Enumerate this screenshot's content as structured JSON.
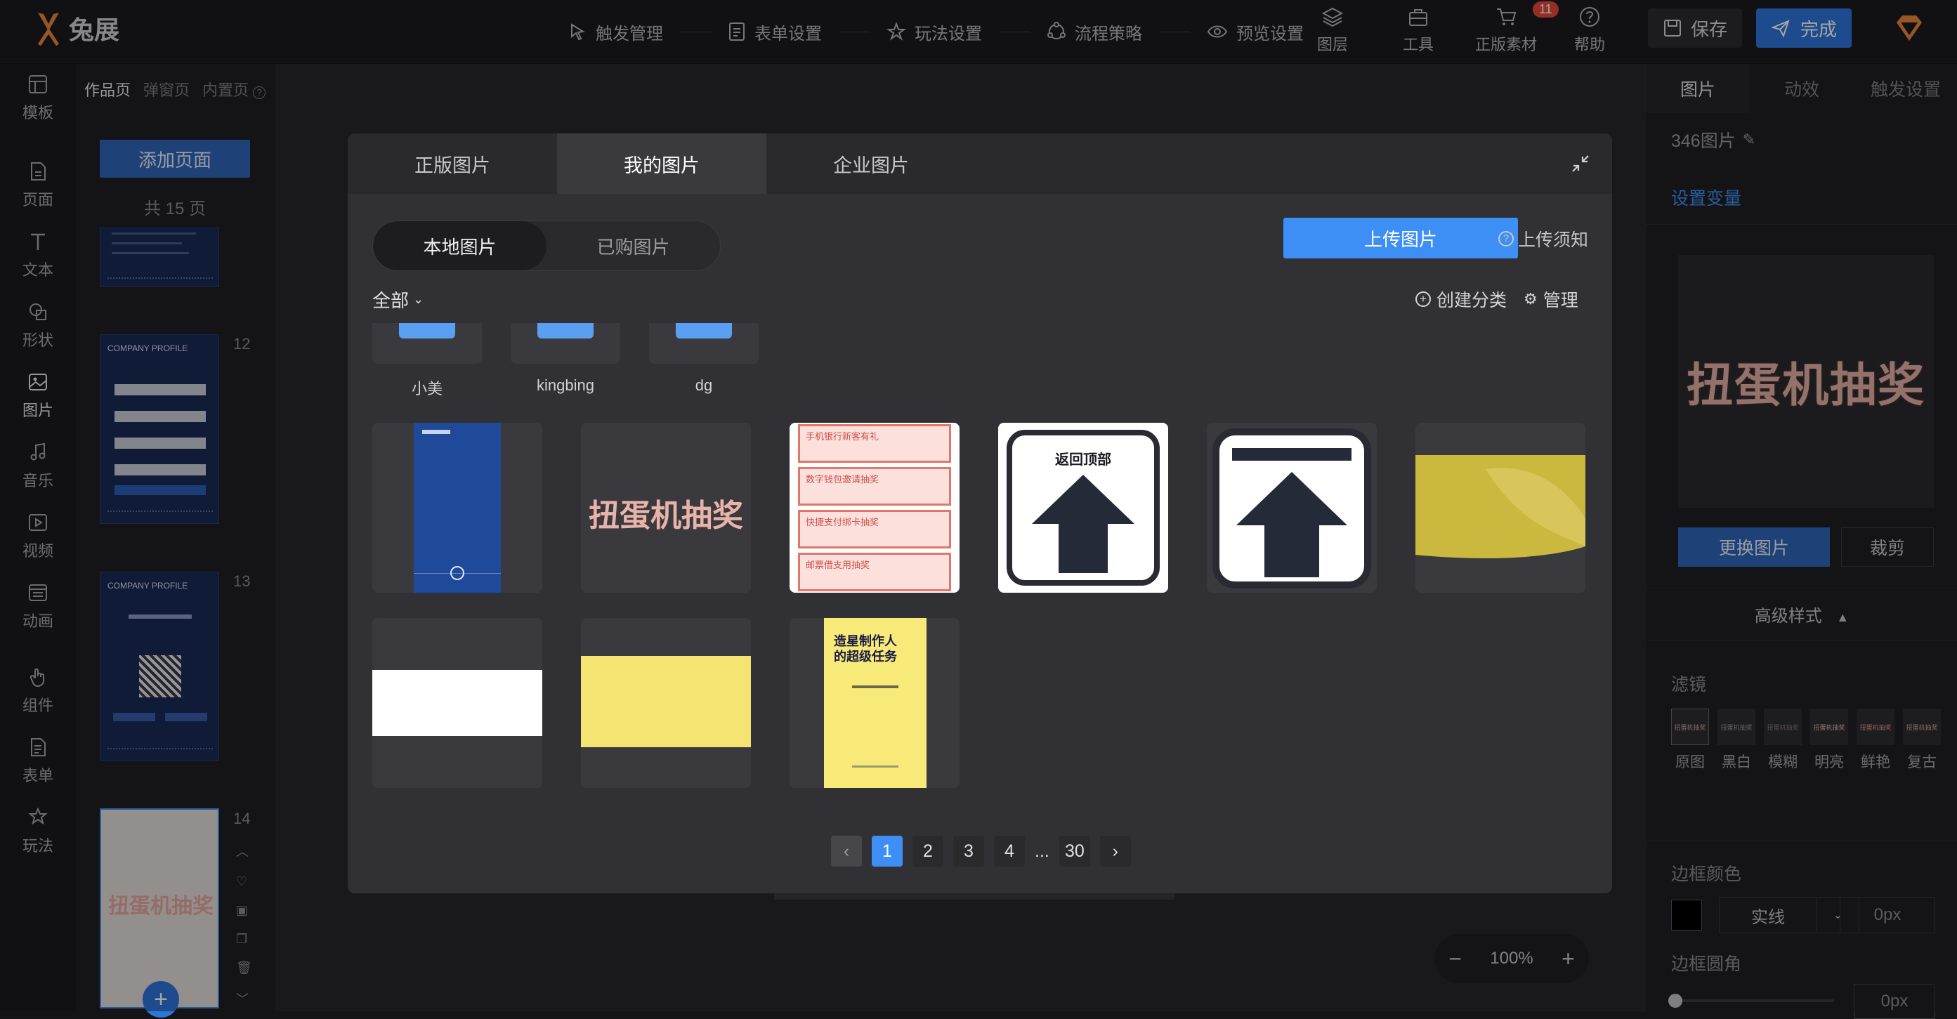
{
  "app": {
    "logo": "兔展"
  },
  "nav_steps": [
    "触发管理",
    "表单设置",
    "玩法设置",
    "流程策略",
    "预览设置"
  ],
  "tools": [
    {
      "label": "图层",
      "icon": "layers-icon"
    },
    {
      "label": "工具",
      "icon": "toolbox-icon"
    },
    {
      "label": "正版素材",
      "icon": "cart-icon",
      "badge": "11"
    },
    {
      "label": "帮助",
      "icon": "help-icon"
    }
  ],
  "actions": {
    "save": "保存",
    "done": "完成"
  },
  "rail": [
    {
      "label": "模板",
      "icon": "template-icon"
    },
    {
      "label": "页面",
      "icon": "page-icon"
    },
    {
      "label": "文本",
      "icon": "text-icon"
    },
    {
      "label": "形状",
      "icon": "shape-icon"
    },
    {
      "label": "图片",
      "icon": "image-icon"
    },
    {
      "label": "音乐",
      "icon": "music-icon"
    },
    {
      "label": "视频",
      "icon": "video-icon"
    },
    {
      "label": "动画",
      "icon": "animation-icon"
    },
    {
      "label": "组件",
      "icon": "component-icon"
    },
    {
      "label": "表单",
      "icon": "form-icon"
    },
    {
      "label": "玩法",
      "icon": "play-icon"
    }
  ],
  "pages_panel": {
    "tabs": [
      "作品页",
      "弹窗页",
      "内置页"
    ],
    "add_page": "添加页面",
    "total": "共 15 页",
    "thumb_nums": [
      "12",
      "13",
      "14"
    ],
    "thumb12_title": "COMPANY PROFILE",
    "thumb13_title": "COMPANY PROFILE",
    "thumb14_text": "扭蛋机抽奖"
  },
  "zoom": {
    "value": "100%",
    "minus": "−",
    "plus": "+"
  },
  "props": {
    "tabs": [
      "图片",
      "动效",
      "触发设置"
    ],
    "image_name": "346图片",
    "set_variable": "设置变量",
    "preview_text": "扭蛋机抽奖",
    "replace": "更换图片",
    "crop": "裁剪",
    "advanced": "高级样式",
    "filter_label": "滤镜",
    "filters": [
      "原图",
      "黑白",
      "模糊",
      "明亮",
      "鲜艳",
      "复古"
    ],
    "border_color_label": "边框颜色",
    "border_style": "实线",
    "border_width": "0px",
    "radius_label": "边框圆角",
    "radius_value": "0px"
  },
  "modal": {
    "tabs": [
      "正版图片",
      "我的图片",
      "企业图片"
    ],
    "seg": [
      "本地图片",
      "已购图片"
    ],
    "upload": "上传图片",
    "upload_notice": "上传须知",
    "filter": "全部",
    "create_category": "创建分类",
    "manage": "管理",
    "folders": [
      "小美",
      "kingbing",
      "dg"
    ],
    "tile_texts": {
      "lottery": "扭蛋机抽奖",
      "list": [
        "手机银行新客有礼",
        "数字钱包邀请抽奖",
        "快捷支付绑卡抽奖",
        "邮票借支用抽奖"
      ],
      "back_top": "返回顶部",
      "poster_line1": "造星制作人",
      "poster_line2": "的超级任务"
    },
    "pager": {
      "pages": [
        "1",
        "2",
        "3",
        "4"
      ],
      "ellipsis": "...",
      "last": "30",
      "current": "1"
    }
  }
}
